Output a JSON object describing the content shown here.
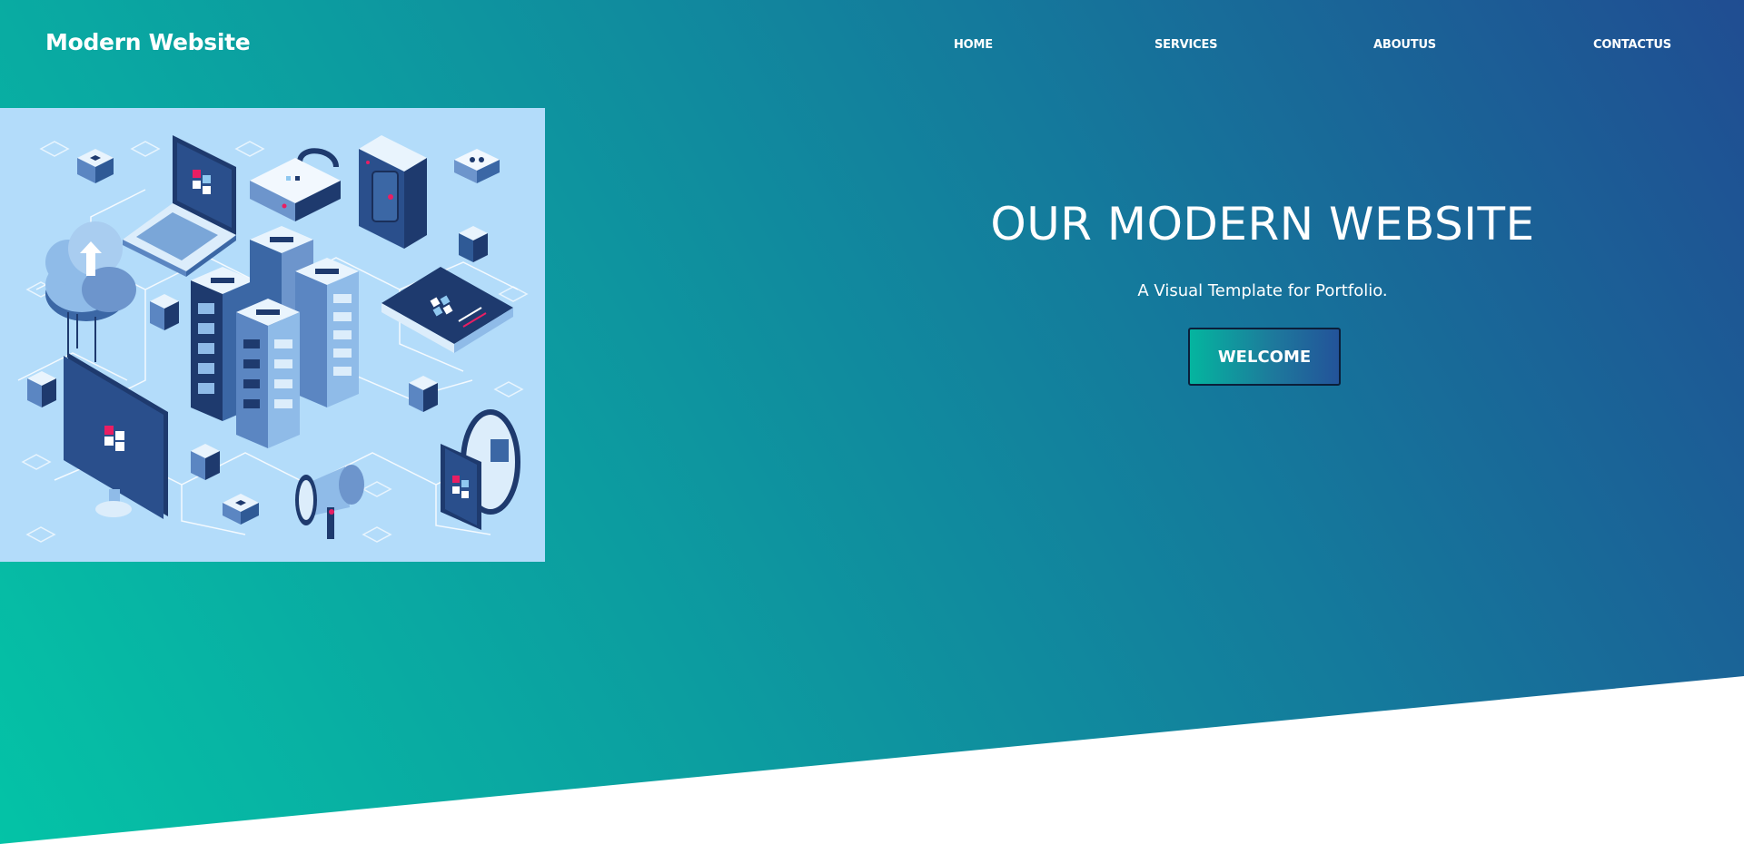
{
  "brand": {
    "title": "Modern Website"
  },
  "nav": {
    "items": [
      {
        "label": "HOME"
      },
      {
        "label": "SERVICES"
      },
      {
        "label": "ABOUTUS"
      },
      {
        "label": "CONTACTUS"
      }
    ]
  },
  "hero": {
    "title": "OUR MODERN WEBSITE",
    "subtitle": "A Visual Template for Portfolio.",
    "button_label": "WELCOME",
    "illustration": "isometric-network-technology-illustration"
  },
  "colors": {
    "gradient_start": "#04c3a6",
    "gradient_end": "#204d92",
    "illustration_bg": "#b3dcfa",
    "illustration_dark": "#1e3a6e",
    "accent_pink": "#e91e63"
  }
}
